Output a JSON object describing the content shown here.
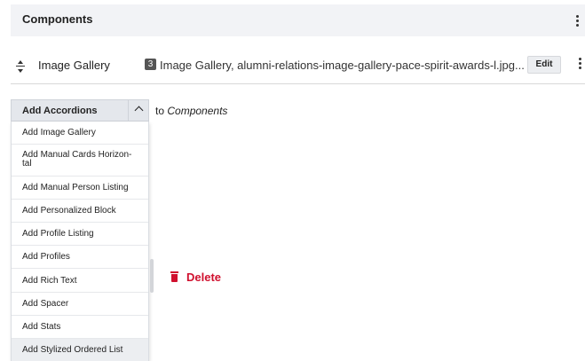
{
  "header": {
    "title": "Components"
  },
  "row": {
    "name": "Image Gallery",
    "badge": "3",
    "summary": "Image Gallery, alumni-relations-image-gallery-pace-spirit-awards-l.jpg...",
    "edit_label": "Edit"
  },
  "add": {
    "selected": "Add Accordions",
    "to_prefix": "to",
    "to_target": "Components"
  },
  "menu": {
    "items": [
      "Add Image Gallery",
      "Add Manual Cards Horizon-\ntal",
      "Add Manual Person Listing",
      "Add Personalized Block",
      "Add Profile Listing",
      "Add Profiles",
      "Add Rich Text",
      "Add Spacer",
      "Add Stats",
      "Add Stylized Ordered List"
    ]
  },
  "delete": {
    "label": "Delete"
  },
  "colors": {
    "danger": "#d0102e",
    "header_bg": "#f2f3f6"
  },
  "icons": [
    "kebab-menu-icon",
    "drag-handle-icon",
    "chevron-up-icon",
    "trash-icon"
  ]
}
